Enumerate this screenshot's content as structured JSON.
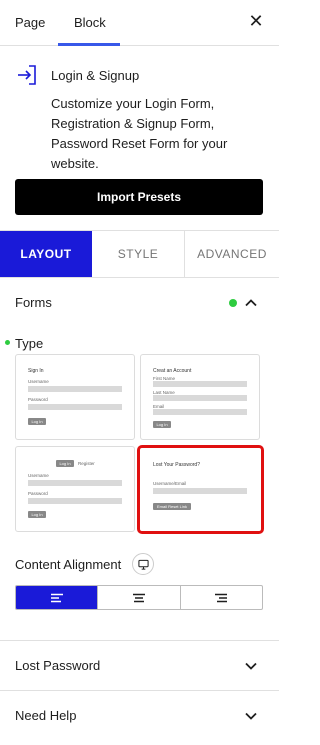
{
  "tabs": {
    "page": "Page",
    "block": "Block"
  },
  "block": {
    "title": "Login & Signup",
    "description": "Customize your Login Form, Registration & Signup Form, Password Reset Form for your website.",
    "icon": "login-arrow-icon"
  },
  "import_presets_label": "Import Presets",
  "settings_tabs": {
    "layout": "LAYOUT",
    "style": "STYLE",
    "advanced": "ADVANCED"
  },
  "forms_panel": {
    "title": "Forms",
    "status_color": "#2ecc40"
  },
  "type_label": "Type",
  "templates": {
    "signin": {
      "title": "Sign In",
      "username": "Username",
      "password": "Password",
      "button": "Log In"
    },
    "create": {
      "title": "Creat an Account",
      "first": "First Name",
      "last": "Last Name",
      "email": "Email",
      "button": "Log In"
    },
    "tabbed": {
      "tab_login": "Log In",
      "tab_register": "Register",
      "username": "Username",
      "password": "Password",
      "button": "Log In"
    },
    "lost": {
      "title": "Lost Your Password?",
      "field": "Username/Email",
      "button": "Email Reset Link"
    }
  },
  "content_alignment_label": "Content Alignment",
  "alignment": {
    "selected": "left",
    "options": [
      "left",
      "center",
      "right"
    ]
  },
  "lost_password_label": "Lost Password",
  "need_help_label": "Need Help",
  "colors": {
    "accent": "#1a1ad8",
    "highlight": "#e01010",
    "tab_underline": "#3858e9"
  }
}
